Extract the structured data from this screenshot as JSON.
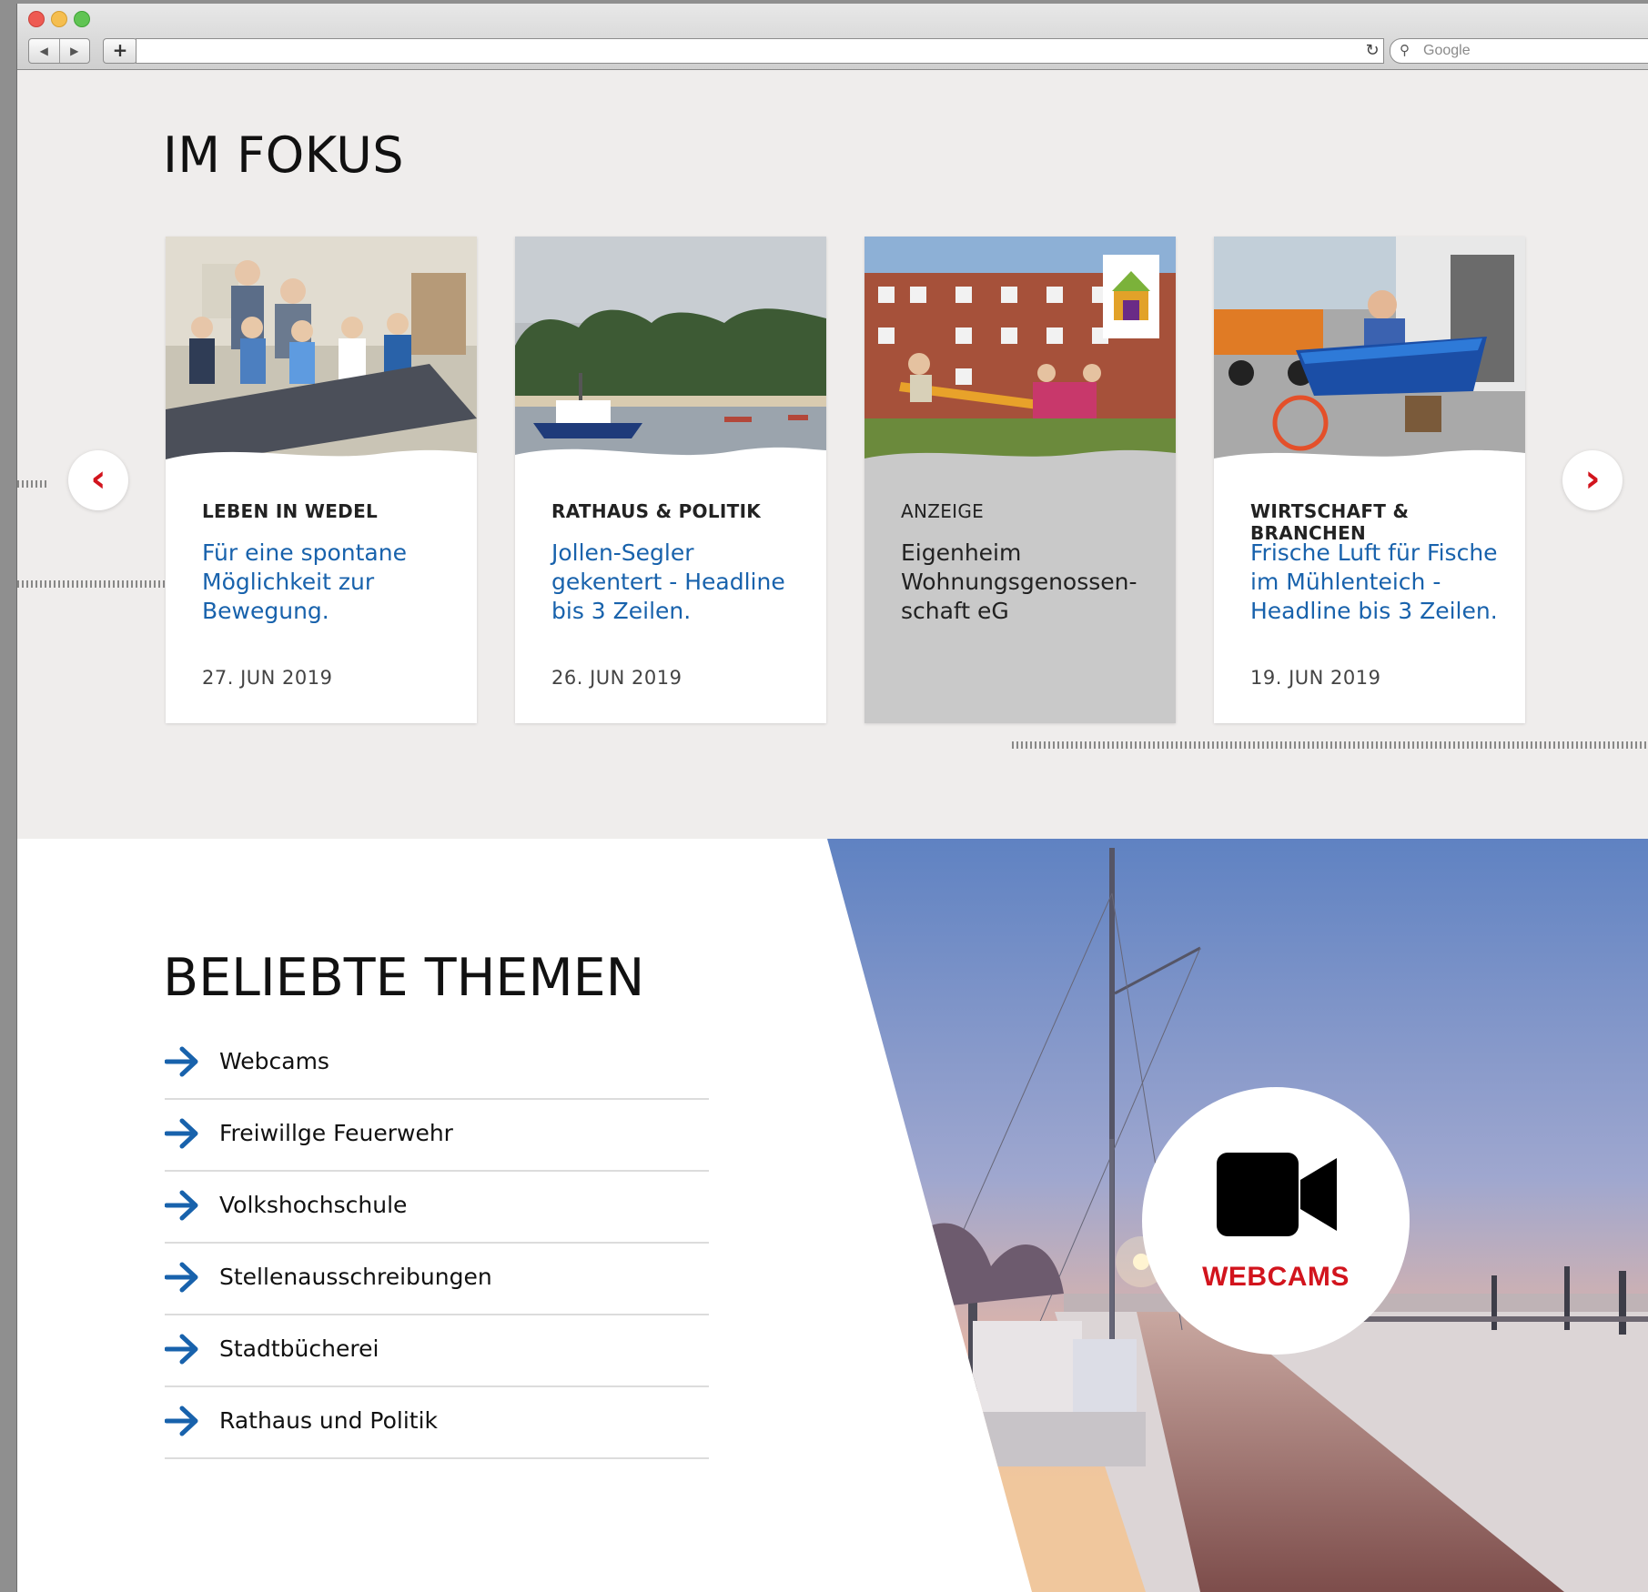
{
  "browser": {
    "search_placeholder": "Google",
    "back_icon": "back-arrow-icon",
    "forward_icon": "forward-arrow-icon",
    "new_tab_label": "+",
    "reload_icon": "reload-icon"
  },
  "fokus": {
    "title": "IM FOKUS",
    "cards": [
      {
        "category": "LEBEN IN WEDEL",
        "headline": "Für eine spontane Möglichkeit zur Bewegung.",
        "date": "27. JUN 2019"
      },
      {
        "category": "RATHAUS & POLITIK",
        "headline": "Jollen-Segler gekentert - Headline bis 3 Zeilen.",
        "date": "26. JUN 2019"
      },
      {
        "category": "ANZEIGE",
        "headline": "Eigenheim Wohnungsgenossen-schaft eG",
        "date": ""
      },
      {
        "category": "WIRTSCHAFT & BRANCHEN",
        "headline": "Frische Luft für Fische im Mühlenteich - Headline bis 3 Zeilen.",
        "date": "19. JUN 2019"
      }
    ],
    "prev_icon": "chevron-left-icon",
    "next_icon": "chevron-right-icon"
  },
  "themen": {
    "title": "BELIEBTE THEMEN",
    "items": [
      {
        "label": "Webcams"
      },
      {
        "label": "Freiwillge Feuerwehr"
      },
      {
        "label": "Volkshochschule"
      },
      {
        "label": "Stellenausschreibungen"
      },
      {
        "label": "Stadtbücherei"
      },
      {
        "label": "Rathaus und Politik"
      }
    ],
    "webcam_label": "WEBCAMS",
    "webcam_icon": "video-camera-icon"
  },
  "colors": {
    "accent_red": "#d2141d",
    "link_blue": "#1862ac",
    "section_bg": "#efedec"
  }
}
